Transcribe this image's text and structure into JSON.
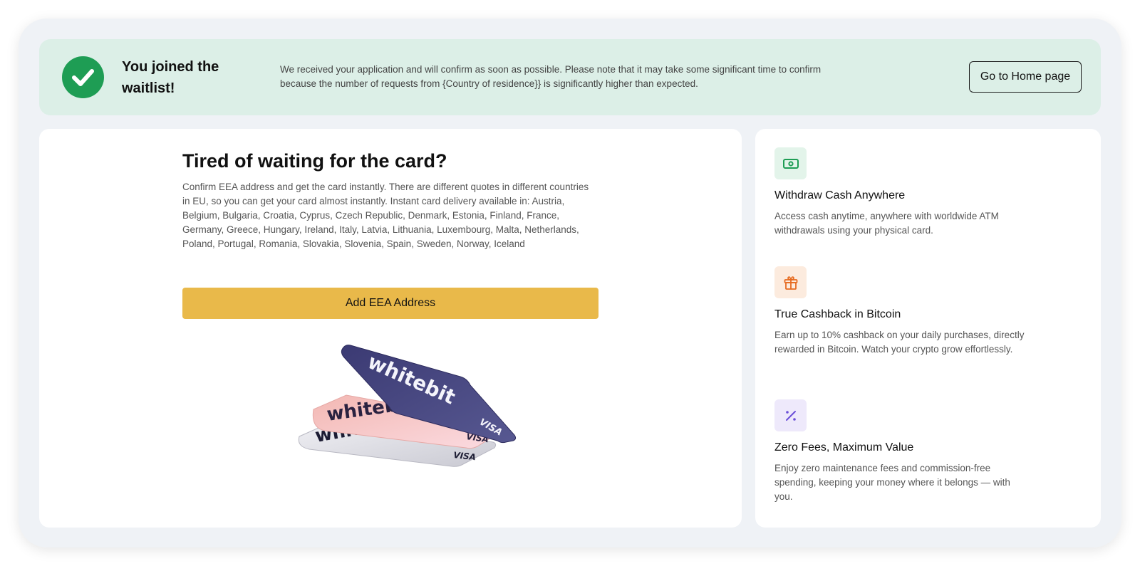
{
  "banner": {
    "title": "You joined the waitlist!",
    "message": "We received your application and will confirm as soon as possible. Please note that it may take some significant time to confirm because the number of requests from {Country of residence}} is significantly higher than expected.",
    "home_button": "Go to Home page",
    "check_icon": "check-icon"
  },
  "promo": {
    "title": "Tired of waiting for the card?",
    "description": "Confirm EEA address and get the card instantly. There are different quotes in different countries in EU, so you can get your card almost instantly. Instant card delivery available in: Austria, Belgium, Bulgaria, Croatia, Cyprus, Czech Republic, Denmark, Estonia, Finland, France, Germany, Greece, Hungary, Ireland, Italy, Latvia, Lithuania, Luxembourg, Malta, Netherlands, Poland, Portugal, Romania, Slovakia, Slovenia, Spain, Sweden, Norway, Iceland",
    "button": "Add EEA Address",
    "card_brand": "whitebit",
    "card_network": "VISA"
  },
  "features": [
    {
      "icon": "cash-icon",
      "title": "Withdraw Cash Anywhere",
      "description": "Access cash anytime, anywhere with worldwide ATM withdrawals using your physical card."
    },
    {
      "icon": "gift-icon",
      "title": "True Cashback in Bitcoin",
      "description": "Earn up to 10% cashback on your daily purchases, directly rewarded in Bitcoin. Watch your crypto grow effortlessly."
    },
    {
      "icon": "percent-icon",
      "title": "Zero Fees, Maximum Value",
      "description": "Enjoy zero maintenance fees and commission-free spending, keeping your money where it belongs — with you."
    }
  ],
  "colors": {
    "banner_bg": "#dcefe7",
    "success_green": "#1e9d54",
    "accent_yellow": "#e9b94a",
    "cash_icon_bg": "#e3f4ea",
    "gift_icon_bg": "#fcebde",
    "percent_icon_bg": "#eee9fb"
  }
}
